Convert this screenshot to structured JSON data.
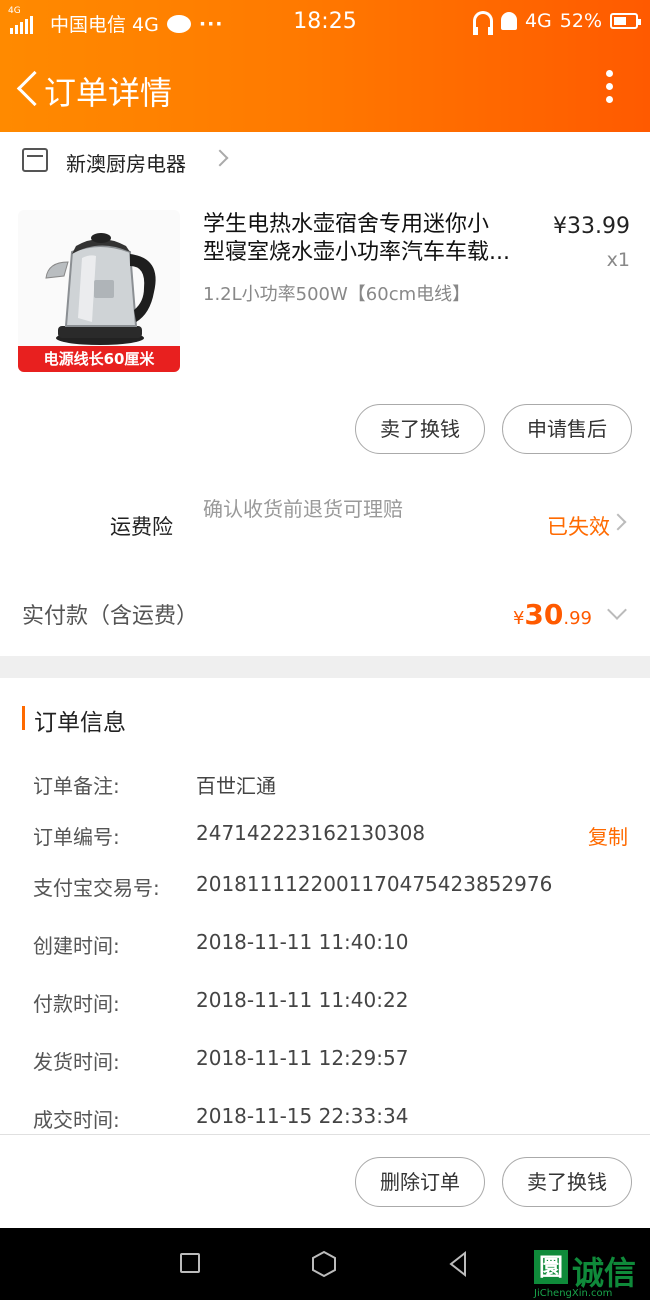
{
  "status_bar": {
    "carrier": "中国电信 4G",
    "network_small": "4G",
    "time": "18:25",
    "right_network": "4G",
    "battery": "52%",
    "dots": "···"
  },
  "header": {
    "title": "订单详情"
  },
  "shop": {
    "name": "新澳厨房电器"
  },
  "product": {
    "title_line1": "学生电热水壶宿舍专用迷你小",
    "title_line2": "型寝室烧水壶小功率汽车车载...",
    "spec": "1.2L小功率500W【60cm电线】",
    "price": "¥33.99",
    "qty": "x1",
    "image_tag": "电源线长60厘米"
  },
  "actions": {
    "sell": "卖了换钱",
    "after_sale": "申请售后"
  },
  "insurance": {
    "label": "运费险",
    "desc": "确认收货前退货可理赔",
    "status": "已失效"
  },
  "payment": {
    "label": "实付款（含运费）",
    "currency": "¥",
    "int": "30",
    "dec": ".99"
  },
  "order_info": {
    "title": "订单信息",
    "copy_label": "复制",
    "rows": [
      {
        "k": "订单备注:",
        "v": "百世汇通"
      },
      {
        "k": "订单编号:",
        "v": "247142223162130308"
      },
      {
        "k": "支付宝交易号:",
        "v": "2018111122001170475423852976"
      },
      {
        "k": "创建时间:",
        "v": "2018-11-11 11:40:10"
      },
      {
        "k": "付款时间:",
        "v": "2018-11-11 11:40:22"
      },
      {
        "k": "发货时间:",
        "v": "2018-11-11 12:29:57"
      },
      {
        "k": "成交时间:",
        "v": "2018-11-15 22:33:34"
      }
    ]
  },
  "bottom_actions": {
    "delete": "删除订单",
    "sell": "卖了换钱"
  },
  "watermark": {
    "mark": "圜",
    "text": "诚信",
    "url": "JiChengXin.com"
  },
  "colors": {
    "accent": "#ff6a00",
    "header_start": "#ff8a00",
    "header_end": "#ff5a00"
  }
}
